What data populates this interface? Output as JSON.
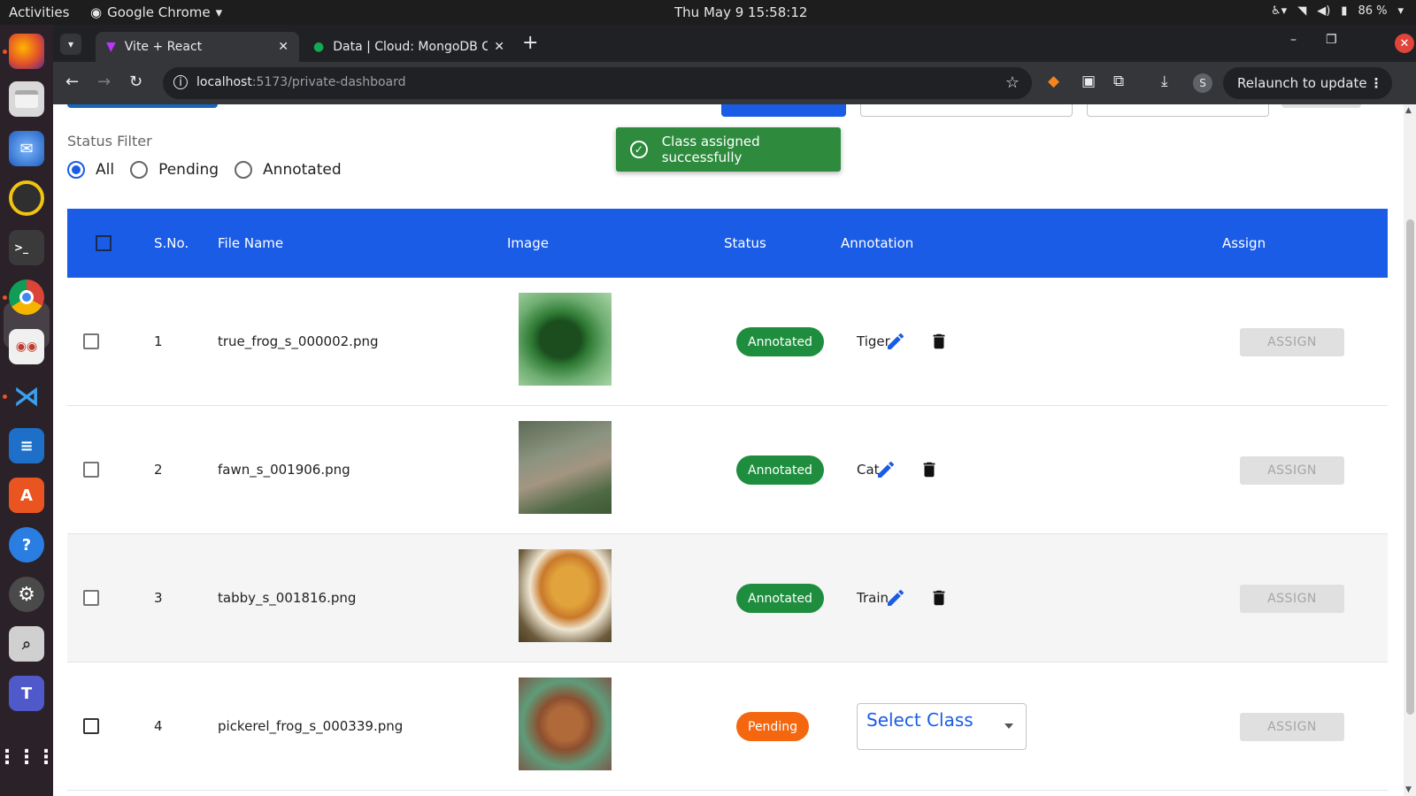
{
  "system": {
    "activities": "Activities",
    "app_name": "Google Chrome",
    "clock": "Thu May 9  15:58:12",
    "battery": "86 %"
  },
  "browser": {
    "tabs": [
      {
        "label": "Vite + React",
        "active": true
      },
      {
        "label": "Data | Cloud: MongoDB C",
        "active": false
      }
    ],
    "url_host": "localhost",
    "url_path": ":5173/private-dashboard",
    "profile_initial": "S",
    "relaunch_label": "Relaunch to update"
  },
  "page": {
    "filter_label": "Status Filter",
    "filter_options": [
      {
        "label": "All",
        "selected": true
      },
      {
        "label": "Pending",
        "selected": false
      },
      {
        "label": "Annotated",
        "selected": false
      }
    ],
    "toast": "Class assigned successfully",
    "table": {
      "headers": [
        "S.No.",
        "File Name",
        "Image",
        "Status",
        "Annotation",
        "Assign"
      ],
      "rows": [
        {
          "sno": "1",
          "file": "true_frog_s_000002.png",
          "status": "Annotated",
          "annotation": "Tiger",
          "assign": "ASSIGN"
        },
        {
          "sno": "2",
          "file": "fawn_s_001906.png",
          "status": "Annotated",
          "annotation": "Cat",
          "assign": "ASSIGN"
        },
        {
          "sno": "3",
          "file": "tabby_s_001816.png",
          "status": "Annotated",
          "annotation": "Train",
          "assign": "ASSIGN"
        },
        {
          "sno": "4",
          "file": "pickerel_frog_s_000339.png",
          "status": "Pending",
          "annotation_placeholder": "Select Class",
          "assign": "ASSIGN"
        }
      ]
    }
  },
  "colors": {
    "accent": "#1a5ce6",
    "annotated": "#1e8e3e",
    "pending": "#f4670f",
    "toast": "#2e8b3e"
  }
}
